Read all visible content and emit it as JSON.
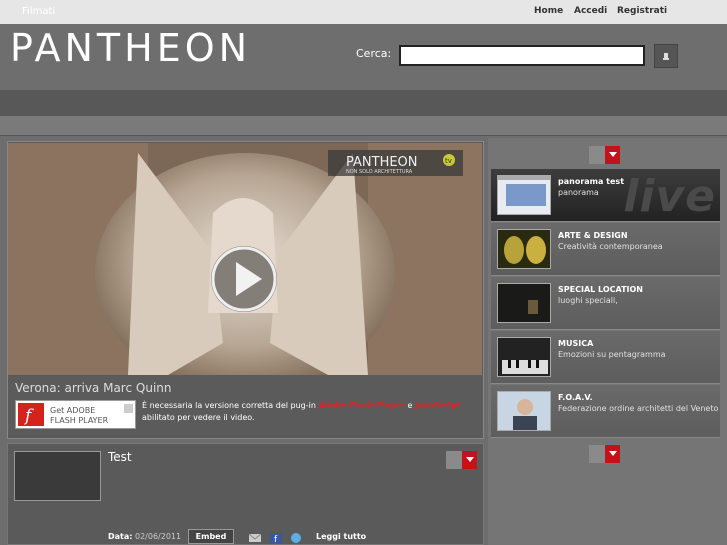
{
  "top_nav": {
    "home": "Home",
    "accedi": "Accedi",
    "registrati": "Registrati"
  },
  "header": {
    "logo": "PANTHEON",
    "search_label": "Cerca:",
    "search_value": ""
  },
  "nav": {
    "filmati": "Filmati"
  },
  "video": {
    "watermark": "PANTHEON",
    "watermark_tv": "tv",
    "watermark_sub": "NON SOLO ARCHITETTURA",
    "title": "Verona: arriva Marc Quinn",
    "flash_badge_line1": "Get ADOBE",
    "flash_badge_line2": "FLASH PLAYER",
    "note_part1": "È necessaria la versione corretta del pug-in ",
    "note_flash": "Adobe Flash Player",
    "note_and": " e ",
    "note_js": "JavaScript",
    "note_part2": " abilitato per vedere il video."
  },
  "detail": {
    "title": "Test",
    "data_label": "Data:",
    "data_value": "02/06/2011",
    "embed_label": "Embed",
    "read_all": "Leggi tutto"
  },
  "sidebar": {
    "watermark": "live",
    "categories": [
      {
        "title": "panorama test",
        "subtitle": "panorama"
      },
      {
        "title": "ARTE & DESIGN",
        "subtitle": "Creatività contemporanea"
      },
      {
        "title": "SPECIAL LOCATION",
        "subtitle": "luoghi speciali,"
      },
      {
        "title": "MUSICA",
        "subtitle": "Emozioni su pentagramma"
      },
      {
        "title": "F.O.A.V.",
        "subtitle": "Federazione ordine architetti del Veneto"
      }
    ]
  },
  "colors": {
    "accent_red": "#c3131a",
    "link_red": "#e02424"
  }
}
